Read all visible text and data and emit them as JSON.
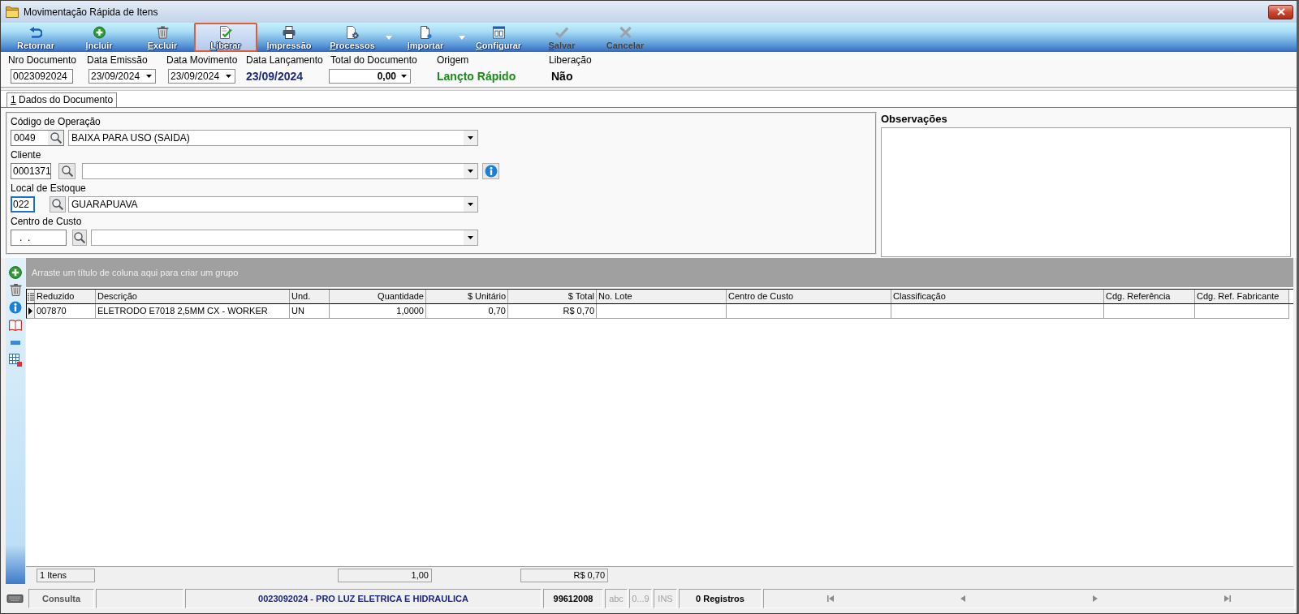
{
  "window": {
    "title": "Movimentação Rápida de Itens"
  },
  "toolbar": [
    {
      "label": "Retornar",
      "mnemonic": false,
      "selected": false,
      "disabled": false,
      "dropdown": false
    },
    {
      "label": "Incluir",
      "mnemonic": true,
      "selected": false,
      "disabled": false,
      "dropdown": false
    },
    {
      "label": "Excluir",
      "mnemonic": true,
      "selected": false,
      "disabled": false,
      "dropdown": false
    },
    {
      "label": "Liberar",
      "mnemonic": true,
      "selected": true,
      "disabled": false,
      "dropdown": false
    },
    {
      "label": "Impressão",
      "mnemonic": true,
      "selected": false,
      "disabled": false,
      "dropdown": false
    },
    {
      "label": "Processos",
      "mnemonic": true,
      "selected": false,
      "disabled": false,
      "dropdown": true
    },
    {
      "label": "Importar",
      "mnemonic": true,
      "selected": false,
      "disabled": false,
      "dropdown": true
    },
    {
      "label": "Configurar",
      "mnemonic": true,
      "selected": false,
      "disabled": false,
      "dropdown": false
    },
    {
      "label": "Salvar",
      "mnemonic": true,
      "selected": false,
      "disabled": true,
      "dropdown": false
    },
    {
      "label": "Cancelar",
      "mnemonic": false,
      "selected": false,
      "disabled": true,
      "dropdown": false
    }
  ],
  "header_fields": [
    {
      "kind": "text",
      "label": "Nro Documento",
      "value": "0023092024"
    },
    {
      "kind": "date",
      "label": "Data Emissão",
      "value": "23/09/2024"
    },
    {
      "kind": "date",
      "label": "Data Movimento",
      "value": "23/09/2024"
    },
    {
      "kind": "display",
      "label": "Data Lançamento",
      "value": "23/09/2024",
      "color": "#1c2a82"
    },
    {
      "kind": "total",
      "label": "Total do Documento",
      "value": "0,00"
    },
    {
      "kind": "display",
      "label": "Origem",
      "value": "Lançto Rápido",
      "color": "#1b8a1b"
    },
    {
      "kind": "display",
      "label": "Liberação",
      "value": "Não",
      "color": "#000000"
    }
  ],
  "tabs": [
    {
      "label": "1 Dados do Documento",
      "selected": true,
      "mnemonic": true
    }
  ],
  "document_form": {
    "fields": [
      {
        "label": "Código de Operação",
        "code": "0049",
        "description": "BAIXA PARA USO (SAIDA)",
        "focused": false,
        "info_button": false
      },
      {
        "label": "Cliente",
        "code": "0001371",
        "focused": false,
        "info_button": true
      },
      {
        "label": "Local de Estoque",
        "code": "022",
        "description": "GUARAPUAVA",
        "focused": true,
        "info_button": false
      },
      {
        "label": "Centro de Custo",
        "code": ".  .",
        "focused": false,
        "info_button": false
      }
    ]
  },
  "observations": {
    "label": "Observações"
  },
  "grid": {
    "group_hint": "Arraste um título de coluna aqui para criar um grupo",
    "columns": [
      {
        "label": "Reduzido",
        "kind": "text"
      },
      {
        "label": "Descrição",
        "kind": "text"
      },
      {
        "label": "Und.",
        "kind": "text"
      },
      {
        "label": "Quantidade",
        "kind": "number"
      },
      {
        "label": "$ Unitário",
        "kind": "number"
      },
      {
        "label": "$ Total",
        "kind": "number"
      },
      {
        "label": "No. Lote",
        "kind": "text"
      },
      {
        "label": "Centro de Custo",
        "kind": "text"
      },
      {
        "label": "Classificação",
        "kind": "text"
      },
      {
        "label": "Cdg. Referência",
        "kind": "text"
      },
      {
        "label": "Cdg. Ref. Fabricante",
        "kind": "text"
      }
    ],
    "rows": [
      {
        "current": true,
        "cells": [
          "007870",
          "ELETRODO E7018 2,5MM CX - WORKER",
          "UN",
          "1,0000",
          "0,70",
          "R$ 0,70"
        ]
      }
    ],
    "footer": {
      "count": "1 Itens",
      "quantity_total": "1,00",
      "value_total": "R$ 0,70"
    }
  },
  "status_bar": {
    "mode": "Consulta",
    "document": "0023092024 - PRO LUZ ELETRICA E HIDRAULICA",
    "code": "99612008",
    "indicators": [
      {
        "label": "abc",
        "active": false
      },
      {
        "label": "0...9",
        "active": false
      },
      {
        "label": "INS",
        "active": false
      }
    ],
    "records": "0 Registros"
  }
}
